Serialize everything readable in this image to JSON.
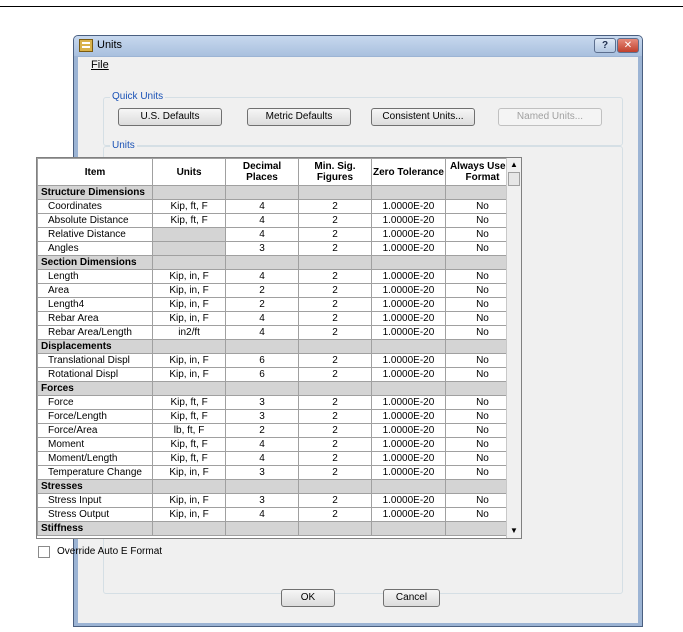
{
  "window": {
    "title": "Units"
  },
  "titlebar": {
    "help": "?",
    "close": "✕"
  },
  "menu": {
    "file": "File"
  },
  "quick_units": {
    "label": "Quick Units",
    "us": "U.S. Defaults",
    "metric": "Metric Defaults",
    "consistent": "Consistent Units...",
    "named": "Named Units..."
  },
  "units_group": {
    "label": "Units"
  },
  "table": {
    "headers": [
      "Item",
      "Units",
      "Decimal Places",
      "Min. Sig. Figures",
      "Zero Tolerance",
      "Always Use E Format"
    ],
    "rows": [
      {
        "section": "Structure Dimensions"
      },
      {
        "item": "Coordinates",
        "units": "Kip, ft, F",
        "dec": "4",
        "sig": "2",
        "tol": "1.0000E-20",
        "efmt": "No"
      },
      {
        "item": "Absolute Distance",
        "units": "Kip, ft, F",
        "dec": "4",
        "sig": "2",
        "tol": "1.0000E-20",
        "efmt": "No"
      },
      {
        "item": "Relative Distance",
        "units": "",
        "dec": "4",
        "sig": "2",
        "tol": "1.0000E-20",
        "efmt": "No"
      },
      {
        "item": "Angles",
        "units": "",
        "dec": "3",
        "sig": "2",
        "tol": "1.0000E-20",
        "efmt": "No"
      },
      {
        "section": "Section Dimensions"
      },
      {
        "item": "Length",
        "units": "Kip, in, F",
        "dec": "4",
        "sig": "2",
        "tol": "1.0000E-20",
        "efmt": "No"
      },
      {
        "item": "Area",
        "units": "Kip, in, F",
        "dec": "2",
        "sig": "2",
        "tol": "1.0000E-20",
        "efmt": "No"
      },
      {
        "item": "Length4",
        "units": "Kip, in, F",
        "dec": "2",
        "sig": "2",
        "tol": "1.0000E-20",
        "efmt": "No"
      },
      {
        "item": "Rebar Area",
        "units": "Kip, in, F",
        "dec": "4",
        "sig": "2",
        "tol": "1.0000E-20",
        "efmt": "No"
      },
      {
        "item": "Rebar Area/Length",
        "units": "in2/ft",
        "dec": "4",
        "sig": "2",
        "tol": "1.0000E-20",
        "efmt": "No"
      },
      {
        "section": "Displacements"
      },
      {
        "item": "Translational Displ",
        "units": "Kip, in, F",
        "dec": "6",
        "sig": "2",
        "tol": "1.0000E-20",
        "efmt": "No"
      },
      {
        "item": "Rotational Displ",
        "units": "Kip, in, F",
        "dec": "6",
        "sig": "2",
        "tol": "1.0000E-20",
        "efmt": "No"
      },
      {
        "section": "Forces"
      },
      {
        "item": "Force",
        "units": "Kip, ft, F",
        "dec": "3",
        "sig": "2",
        "tol": "1.0000E-20",
        "efmt": "No"
      },
      {
        "item": "Force/Length",
        "units": "Kip, ft, F",
        "dec": "3",
        "sig": "2",
        "tol": "1.0000E-20",
        "efmt": "No"
      },
      {
        "item": "Force/Area",
        "units": "lb, ft, F",
        "dec": "2",
        "sig": "2",
        "tol": "1.0000E-20",
        "efmt": "No"
      },
      {
        "item": "Moment",
        "units": "Kip, ft, F",
        "dec": "4",
        "sig": "2",
        "tol": "1.0000E-20",
        "efmt": "No"
      },
      {
        "item": "Moment/Length",
        "units": "Kip, ft, F",
        "dec": "4",
        "sig": "2",
        "tol": "1.0000E-20",
        "efmt": "No"
      },
      {
        "item": "Temperature Change",
        "units": "Kip, in, F",
        "dec": "3",
        "sig": "2",
        "tol": "1.0000E-20",
        "efmt": "No"
      },
      {
        "section": "Stresses"
      },
      {
        "item": "Stress Input",
        "units": "Kip, in, F",
        "dec": "3",
        "sig": "2",
        "tol": "1.0000E-20",
        "efmt": "No"
      },
      {
        "item": "Stress Output",
        "units": "Kip, in, F",
        "dec": "4",
        "sig": "2",
        "tol": "1.0000E-20",
        "efmt": "No"
      },
      {
        "section": "Stiffness"
      }
    ]
  },
  "scrollbar": {
    "up": "▲",
    "down": "▼"
  },
  "override": {
    "label": "Override Auto E Format",
    "checked": false
  },
  "buttons": {
    "ok": "OK",
    "cancel": "Cancel"
  }
}
